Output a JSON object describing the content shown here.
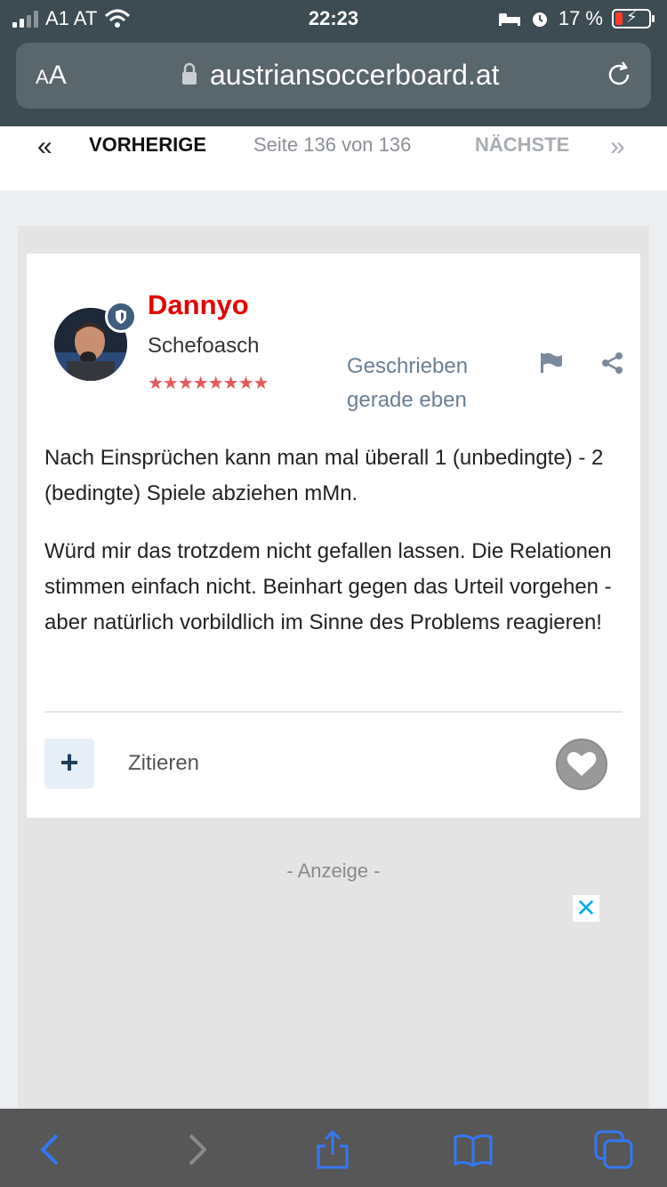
{
  "status_bar": {
    "carrier": "A1 AT",
    "time": "22:23",
    "battery": "17 %"
  },
  "browser": {
    "text_size_label_small": "A",
    "text_size_label_large": "A",
    "url": "austriansoccerboard.at"
  },
  "pagination": {
    "first_symbol": "«",
    "prev_label": "VORHERIGE",
    "page_info": "Seite 136 von 136",
    "next_label": "NÄCHSTE",
    "last_symbol": "»"
  },
  "post": {
    "author": "Dannyo",
    "rank": "Schefoasch",
    "stars": "★★★★★★★★",
    "posted_label": "Geschrieben",
    "posted_time": "gerade eben",
    "paragraphs": [
      "Nach Einsprüchen kann man mal überall 1 (unbedingte) - 2 (bedingte) Spiele abziehen mMn.",
      "Würd mir das trotzdem nicht gefallen lassen. Die Relationen stimmen einfach nicht. Beinhart gegen das Urteil vorgehen - aber natürlich vorbildlich im Sinne des Problems reagieren!"
    ],
    "multiquote_symbol": "+",
    "quote_label": "Zitieren"
  },
  "ad": {
    "label": "- Anzeige -",
    "close_symbol": "✕"
  },
  "colors": {
    "username": "#e50000",
    "accent": "#3478f6",
    "stars": "#e7585a"
  }
}
